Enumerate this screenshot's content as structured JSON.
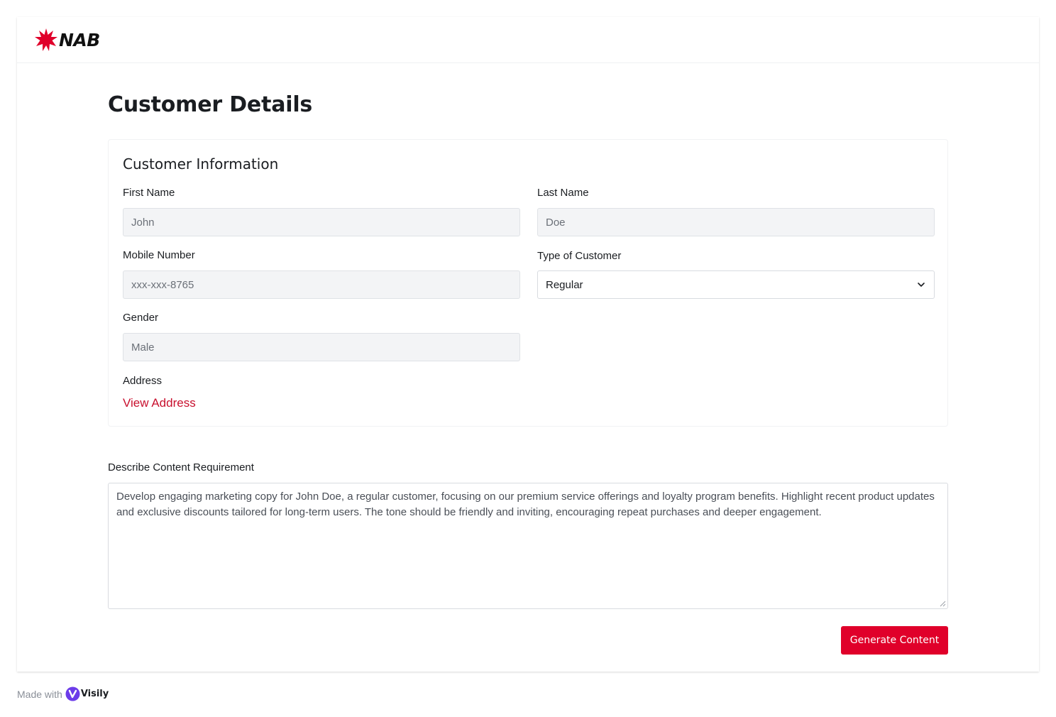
{
  "brand": {
    "logo_text": "NAB",
    "accent_color": "#e0002a",
    "logo_icon": "nab-star-icon"
  },
  "page": {
    "title": "Customer Details"
  },
  "customer_info": {
    "section_title": "Customer Information",
    "first_name": {
      "label": "First Name",
      "value": "John"
    },
    "last_name": {
      "label": "Last Name",
      "value": "Doe"
    },
    "mobile_number": {
      "label": "Mobile Number",
      "value": "xxx-xxx-8765"
    },
    "customer_type": {
      "label": "Type of Customer",
      "selected": "Regular",
      "icon": "chevron-down-icon"
    },
    "gender": {
      "label": "Gender",
      "value": "Male"
    },
    "address": {
      "label": "Address",
      "link_text": "View Address"
    }
  },
  "content_requirement": {
    "label": "Describe Content Requirement",
    "value": "Develop engaging marketing copy for John Doe, a regular customer, focusing on our premium service offerings and loyalty program benefits. Highlight recent product updates and exclusive discounts tailored for long-term users. The tone should be friendly and inviting, encouraging repeat purchases and deeper engagement."
  },
  "actions": {
    "generate_label": "Generate Content"
  },
  "footer": {
    "made_with": "Made with",
    "visily_text": "Visily",
    "visily_icon": "visily-logo-icon"
  }
}
